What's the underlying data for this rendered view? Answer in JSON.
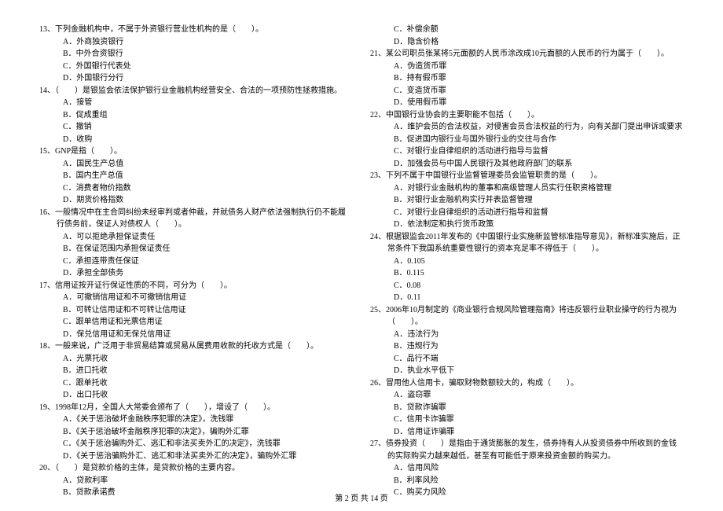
{
  "left": {
    "q13": {
      "text": "13、下列金融机构中，不属于外资银行营业性机构的是（　　）。",
      "A": "A．外商独资银行",
      "B": "B．中外合资银行",
      "C": "C．外国银行代表处",
      "D": "D．外国银行分行"
    },
    "q14": {
      "text": "14、（　　）是银监会依法保护银行业金融机构经营安全、合法的一项预防性拯救措施。",
      "A": "A．接管",
      "B": "B．促成重组",
      "C": "C．撤销",
      "D": "D．收购"
    },
    "q15": {
      "text": "15、GNP是指（　　）。",
      "A": "A．国民生产总值",
      "B": "B．国内生产总值",
      "C": "C．消费者物价指数",
      "D": "D．期货价格指数"
    },
    "q16": {
      "text": "16、一般情况中在主合同纠纷未经审判或者仲裁，并就债务人财产依法强制执行仍不能履行债务前，保证人对债权人（　　）。",
      "A": "A．可以拒绝承担保证责任",
      "B": "B．在保证范围内承担保证责任",
      "C": "C．承担连带责任保证",
      "D": "D．承担全部债务"
    },
    "q17": {
      "text": "17、信用证按开证行保证性质的不同，可分为（　　）。",
      "A": "A．可撤销信用证和不可撤销信用证",
      "B": "B．可转让信用证和不可转让信用证",
      "C": "C．跟单信用证和光票信用证",
      "D": "D．保兑信用证和无保兑信用证"
    },
    "q18": {
      "text": "18、一般来说，广泛用于非贸易结算或贸易从属费用收款的托收方式是（　　）。",
      "A": "A．光票托收",
      "B": "B．进口托收",
      "C": "C．跟单托收",
      "D": "D．出口托收"
    },
    "q19": {
      "text": "19、1998年12月，全国人大常委会颁布了（　　），增设了（　　）。",
      "A": "A．《关于惩治破坏金融秩序犯罪的决定》，洗钱罪",
      "B": "B．《关于惩治破坏金融秩序犯罪的决定》，骗购外汇罪",
      "C": "C．《关于惩治骗购外汇、逃汇和非法买卖外汇的决定》，洗钱罪",
      "D": "D．《关于惩治骗购外汇、逃汇和非法买卖外汇的决定》，骗购外汇罪"
    },
    "q20": {
      "text": "20、（　　）是贷款价格的主体，是贷款价格的主要内容。",
      "A": "A．贷款利率",
      "B": "B．贷款承诺费"
    }
  },
  "right": {
    "q20cd": {
      "C": "C．补偿余额",
      "D": "D．隐含价格"
    },
    "q21": {
      "text": "21、某公司职员张某将5元面额的人民币涂改成10元面额的人民币的行为属于（　　）。",
      "A": "A．伪造货币罪",
      "B": "B．持有假币罪",
      "C": "C．变造货币罪",
      "D": "D．使用假币罪"
    },
    "q22": {
      "text": "22、中国银行业协会的主要职能不包括（　　）。",
      "A": "A．维护会员的合法权益，对侵害会员合法权益的行为，向有关部门提出申诉或要求",
      "B": "B．促进国内银行业与国外银行业的交往与合作",
      "C": "C．对银行业自律组织的活动进行指导与监督",
      "D": "D．加强会员与中国人民银行及其他政府部门的联系"
    },
    "q23": {
      "text": "23、下列不属于中国银行业监督管理委员会监管职责的是（　　）。",
      "A": "A．对银行业金融机构的董事和高级管理人员实行任职资格管理",
      "B": "B．对银行业金融机构实行并表监督管理",
      "C": "C．对银行业自律组织的活动进行指导和监督",
      "D": "D．依法制定和执行货币政策"
    },
    "q24": {
      "text": "24、根据银监会2011年发布的《中国银行业实施新监管标准指导意见》，新标准实施后，正常条件下我国系统重要性银行的资本充足率不得低于（　　）。",
      "A": "A．0.105",
      "B": "B．0.115",
      "C": "C．0.08",
      "D": "D．0.11"
    },
    "q25": {
      "text": "25、2006年10月制定的《商业银行合规风险管理指南》将违反银行业职业操守的行为视为（　　）。",
      "A": "A．违法行为",
      "B": "B．违规行为",
      "C": "C．品行不端",
      "D": "D．执业水平低下"
    },
    "q26": {
      "text": "26、冒用他人信用卡，骗取财物数额较大的，构成（　　）。",
      "A": "A．盗窃罪",
      "B": "B．贷款诈骗罪",
      "C": "C．信用卡诈骗罪",
      "D": "D．信用证诈骗罪"
    },
    "q27": {
      "text": "27、债券投资（　　）是指由于通货膨胀的发生，债券持有人从投资债券中所收到的金钱的实际购买力越来越低，甚至有可能低于原来投资金额的购买力。",
      "A": "A．信用风险",
      "B": "B．利率风险",
      "C": "C．购买力风险"
    }
  },
  "footer": "第 2 页 共 14 页"
}
